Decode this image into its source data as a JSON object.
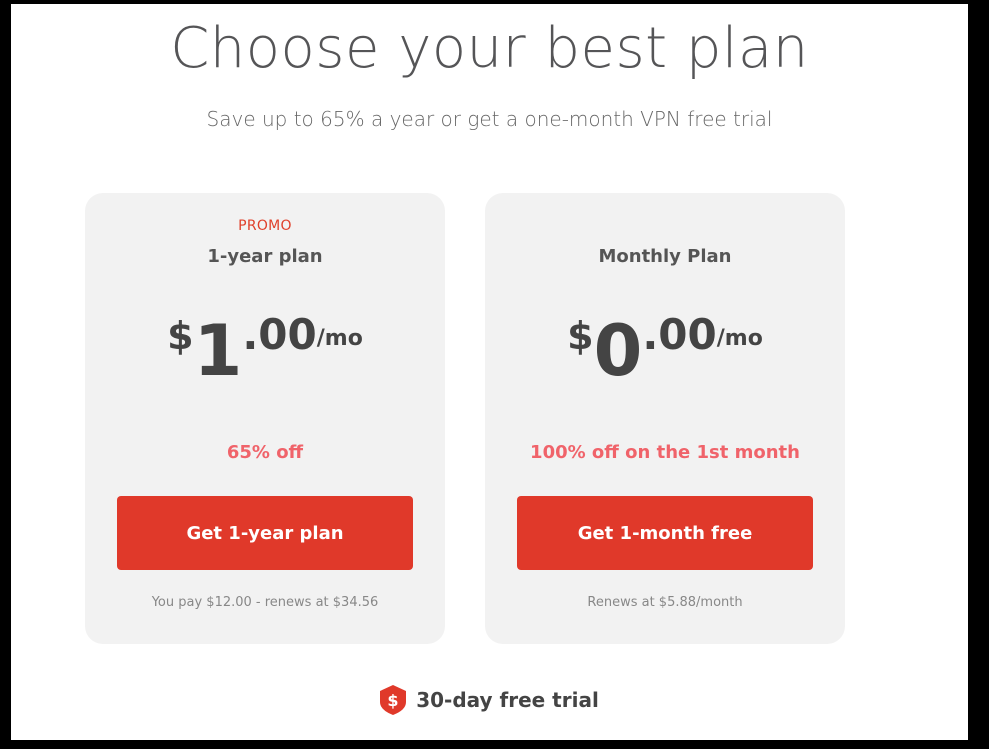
{
  "header": {
    "title": "Choose your best plan",
    "subtitle": "Save up to 65% a year or get a one-month VPN free trial"
  },
  "plans": [
    {
      "badge": "PROMO",
      "name": "1-year plan",
      "price": {
        "currency": "$",
        "whole": "1",
        "cents": ".00",
        "period": "/mo"
      },
      "discount": "65% off",
      "button_label": "Get 1-year plan",
      "note": "You pay $12.00 - renews at $34.56"
    },
    {
      "badge": "",
      "name": "Monthly Plan",
      "price": {
        "currency": "$",
        "whole": "0",
        "cents": ".00",
        "period": "/mo"
      },
      "discount": "100% off on the 1st month",
      "button_label": "Get 1-month free",
      "note": "Renews at $5.88/month"
    }
  ],
  "guarantee": {
    "icon": "dollar-shield-icon",
    "text": "30-day free trial"
  },
  "colors": {
    "accent": "#e0392a",
    "discount": "#f0636a",
    "promo": "#e0402b",
    "card_bg": "#f2f2f2"
  }
}
